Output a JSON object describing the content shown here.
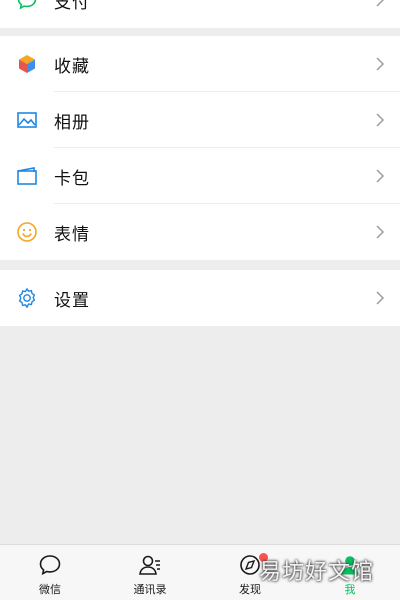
{
  "menu_top": {
    "label": "支付",
    "icon": "chat-bubble-icon"
  },
  "menu_main": [
    {
      "label": "收藏",
      "icon": "cube-icon"
    },
    {
      "label": "相册",
      "icon": "image-icon"
    },
    {
      "label": "卡包",
      "icon": "wallet-icon"
    },
    {
      "label": "表情",
      "icon": "smiley-icon"
    }
  ],
  "menu_settings": {
    "label": "设置",
    "icon": "gear-icon"
  },
  "tabbar": {
    "tabs": [
      {
        "label": "微信",
        "icon": "chat-bubble-icon"
      },
      {
        "label": "通讯录",
        "icon": "contacts-icon"
      },
      {
        "label": "发现",
        "icon": "compass-icon"
      },
      {
        "label": "我",
        "icon": "person-icon"
      }
    ],
    "active_index": 3
  },
  "watermark": "易坊好文馆",
  "colors": {
    "accent_green": "#07c160",
    "badge_red": "#fa5151",
    "icon_blue": "#1e88e5",
    "icon_orange": "#f5a623"
  }
}
